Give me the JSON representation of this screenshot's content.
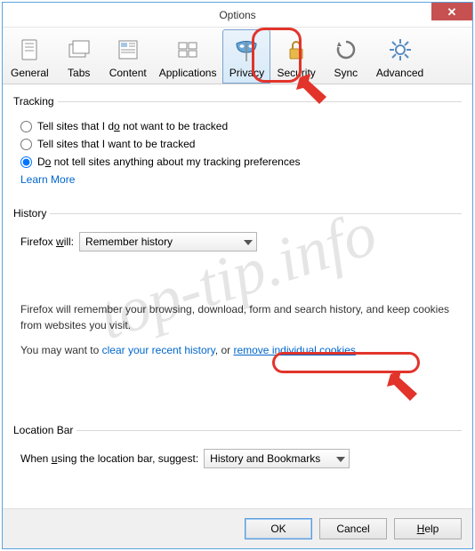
{
  "window": {
    "title": "Options"
  },
  "tabs": {
    "general": "General",
    "tabs": "Tabs",
    "content": "Content",
    "applications": "Applications",
    "privacy": "Privacy",
    "security": "Security",
    "sync": "Sync",
    "advanced": "Advanced"
  },
  "tracking": {
    "legend": "Tracking",
    "opt1_pre": "Tell sites that I d",
    "opt1_u": "o",
    "opt1_post": " not want to be tracked",
    "opt2": "Tell sites that I want to be tracked",
    "opt3_pre": "D",
    "opt3_u": "o",
    "opt3_post": " not tell sites anything about my tracking preferences",
    "learn_more": "Learn More"
  },
  "history": {
    "legend": "History",
    "label_pre": "Firefox ",
    "label_u": "w",
    "label_post": "ill:",
    "select_value": "Remember history",
    "para1": "Firefox will remember your browsing, download, form and search history, and keep cookies from websites you visit.",
    "para2_pre": "You may want to ",
    "link1": "clear your recent history",
    "para2_mid": ", or ",
    "link2": "remove individual cookies",
    "para2_post": "."
  },
  "location": {
    "legend": "Location Bar",
    "label_pre": "When ",
    "label_u": "u",
    "label_post": "sing the location bar, suggest:",
    "select_value": "History and Bookmarks"
  },
  "buttons": {
    "ok": "OK",
    "cancel": "Cancel",
    "help_u": "H",
    "help_post": "elp"
  },
  "watermark": "top-tip.info"
}
